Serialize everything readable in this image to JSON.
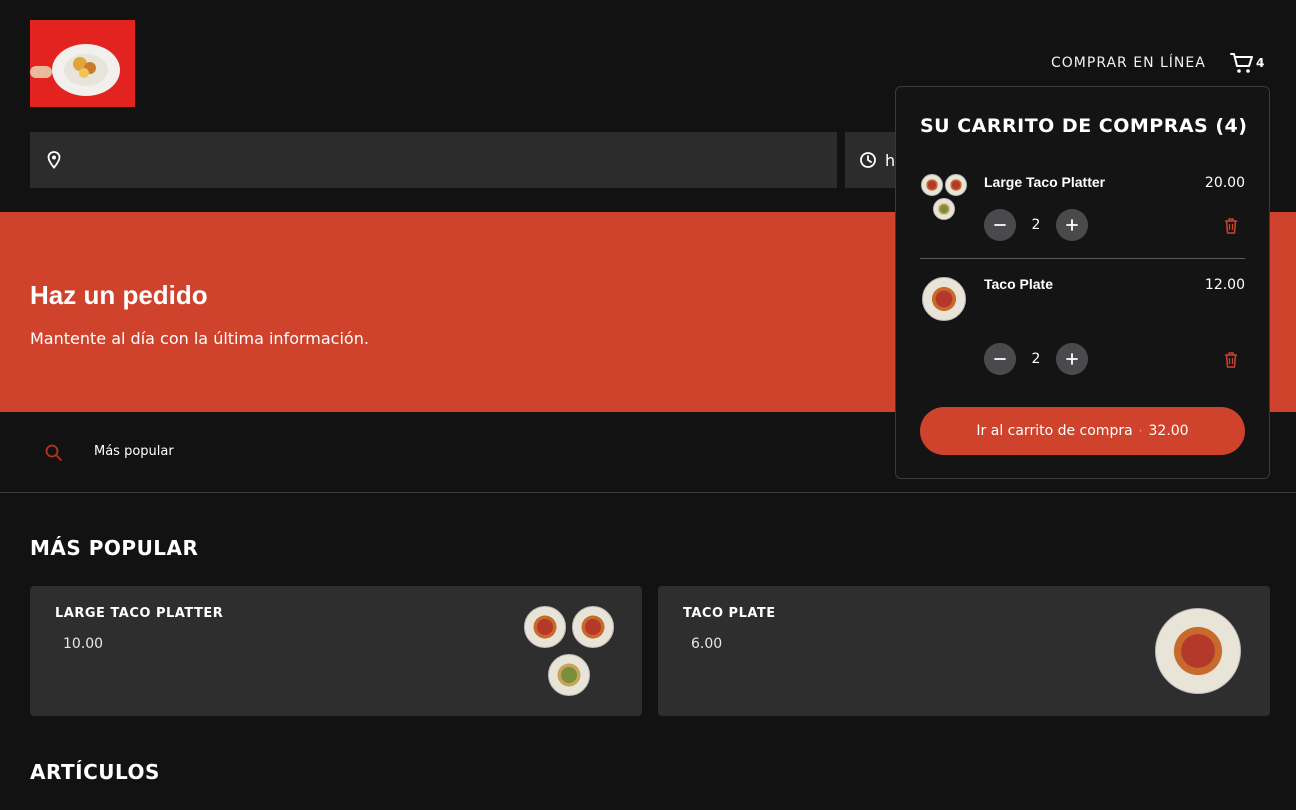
{
  "header": {
    "nav_link": "COMPRAR EN LÍNEA",
    "cart_count": "4"
  },
  "search": {
    "time_text": "h"
  },
  "hero": {
    "title": "Haz un pedido",
    "subtitle": "Mantente al día con la última información."
  },
  "categories": {
    "items": [
      "Más popular"
    ]
  },
  "sections": {
    "popular_title": "Más popular",
    "articles_title": "Artículos"
  },
  "popular_items": [
    {
      "name": "Large Taco Platter",
      "price": "10.00"
    },
    {
      "name": "Taco Plate",
      "price": "6.00"
    }
  ],
  "cart": {
    "title": "Su carrito de compras (4)",
    "items": [
      {
        "name": "Large Taco Platter",
        "price": "20.00",
        "qty": "2"
      },
      {
        "name": "Taco Plate",
        "price": "12.00",
        "qty": "2"
      }
    ],
    "checkout_label": "Ir al carrito de compra",
    "checkout_separator": "·",
    "total": "32.00"
  },
  "colors": {
    "accent": "#cf432c",
    "background": "#121213",
    "card": "#2e2e2f"
  }
}
